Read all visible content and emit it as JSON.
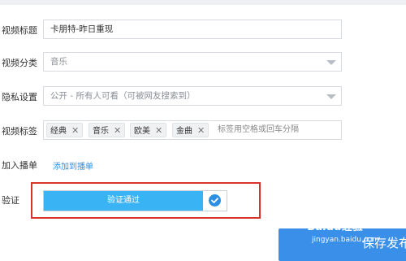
{
  "form": {
    "title_label": "视频标题",
    "title_value": "卡朋特-昨日重现",
    "category_label": "视频分类",
    "category_value": "音乐",
    "privacy_label": "隐私设置",
    "privacy_value": "公开 - 所有人可看（可被网友搜索到）",
    "tags_label": "视频标签",
    "tags": [
      {
        "text": "经典"
      },
      {
        "text": "音乐"
      },
      {
        "text": "欧美"
      },
      {
        "text": "金曲"
      }
    ],
    "tag_remove_glyph": "✕",
    "tags_placeholder": "标签用空格或回车分隔",
    "playlist_label": "加入播单",
    "playlist_link": "添加到播单",
    "verify_label": "验证",
    "verify_text": "验证通过",
    "save_label": "保存发布"
  },
  "watermark": {
    "brand": "Baidu经验",
    "url": "jingyan.baidu.com"
  },
  "colors": {
    "accent": "#3ab3f4",
    "button": "#3a8fe8",
    "highlight_border": "#d9342c",
    "link": "#2d8ee6"
  }
}
